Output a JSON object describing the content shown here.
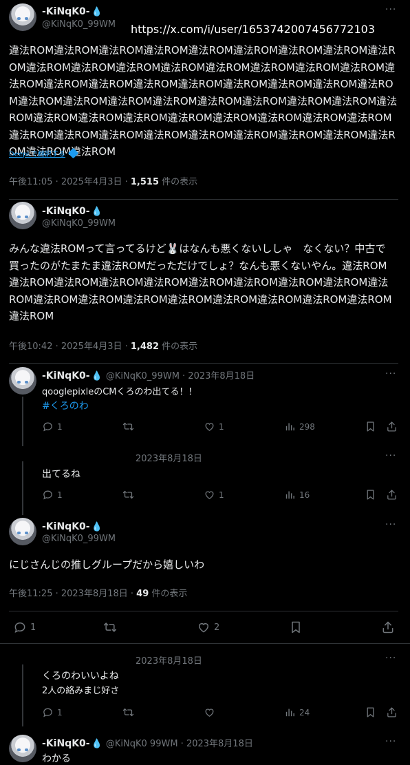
{
  "url_overlay": "https://x.com/i/user/1653742007456772103",
  "more_label": "···",
  "post1": {
    "name": "-KiNqK0-",
    "handle": "@KiNqK0_99WM",
    "text": "違法ROM違法ROM違法ROM違法ROM違法ROM違法ROM違法ROM違法ROM違法ROM違法ROM違法ROM違法ROM違法ROM違法ROM違法ROM違法ROM違法ROM違法ROM違法ROM違法ROM違法ROM違法ROM違法ROM違法ROM違法ROM違法ROM違法ROM違法ROM違法ROM違法ROM違法ROM違法ROM違法ROM違法ROM違法ROM違法ROM違法ROM違法ROM違法ROM違法ROM違法ROM違法ROM違法ROM違法ROM違法ROM違法ROM違法ROM違法ROM違法ROM違法ROM違法ROM違法ROM違法ROM違法ROM",
    "translate": "DeepLで翻訳する",
    "time": "午後11:05 · 2025年4月3日 · ",
    "views": "1,515",
    "views_suffix": " 件の表示"
  },
  "post2": {
    "name": "-KiNqK0-",
    "handle": "@KiNqK0_99WM",
    "text": "みんな違法ROMって言ってるけど🐰はなんも悪くないししゃ　なくない？中古で買ったのがたまたま違法ROMだっただけでしょ？なんも悪くないやん。違法ROM違法ROM違法ROM違法ROM違法ROM違法ROM違法ROM違法ROM違法ROM違法ROM違法ROM違法ROM違法ROM違法ROM違法ROM違法ROM違法ROM違法ROM違法ROM",
    "time": "午後10:42 · 2025年4月3日 · ",
    "views": "1,482",
    "views_suffix": " 件の表示"
  },
  "reply1": {
    "name": "-KiNqK0-",
    "handle_date": "@KiNqK0_99WM · 2023年8月18日",
    "text": "qooglepixleのCMくろのわ出てる！！",
    "hashtag": "#くろのわ",
    "replies": "1",
    "likes": "1",
    "views": "298"
  },
  "reply2": {
    "date": "2023年8月18日",
    "text": "出てるね",
    "replies": "1",
    "likes": "1",
    "views": "16"
  },
  "main": {
    "name": "-KiNqK0-",
    "handle": "@KiNqK0_99WM",
    "text": "にじさんじの推しグループだから嬉しいわ",
    "time": "午後11:25 · 2023年8月18日 · ",
    "views": "49",
    "views_suffix": " 件の表示",
    "replies": "1",
    "likes": "2"
  },
  "reply3": {
    "date": "2023年8月18日",
    "line1": "くろのわいいよね",
    "line2": "2人の絡みまじ好さ",
    "replies": "1",
    "views": "24"
  },
  "reply4": {
    "name": "-KiNqK0-",
    "handle_date": "@KiNqK0 99WM · 2023年8月18日",
    "text": "わかる"
  },
  "icons": [
    "reply-icon",
    "retweet-icon",
    "like-icon",
    "views-icon",
    "bookmark-icon",
    "share-icon",
    "more-icon",
    "deepl-icon",
    "verified-drop-icon"
  ],
  "colors": {
    "background": "#000000",
    "text": "#e7e9ea",
    "muted": "#71767b",
    "accent": "#1d9bf0",
    "divider": "#2f3336"
  }
}
